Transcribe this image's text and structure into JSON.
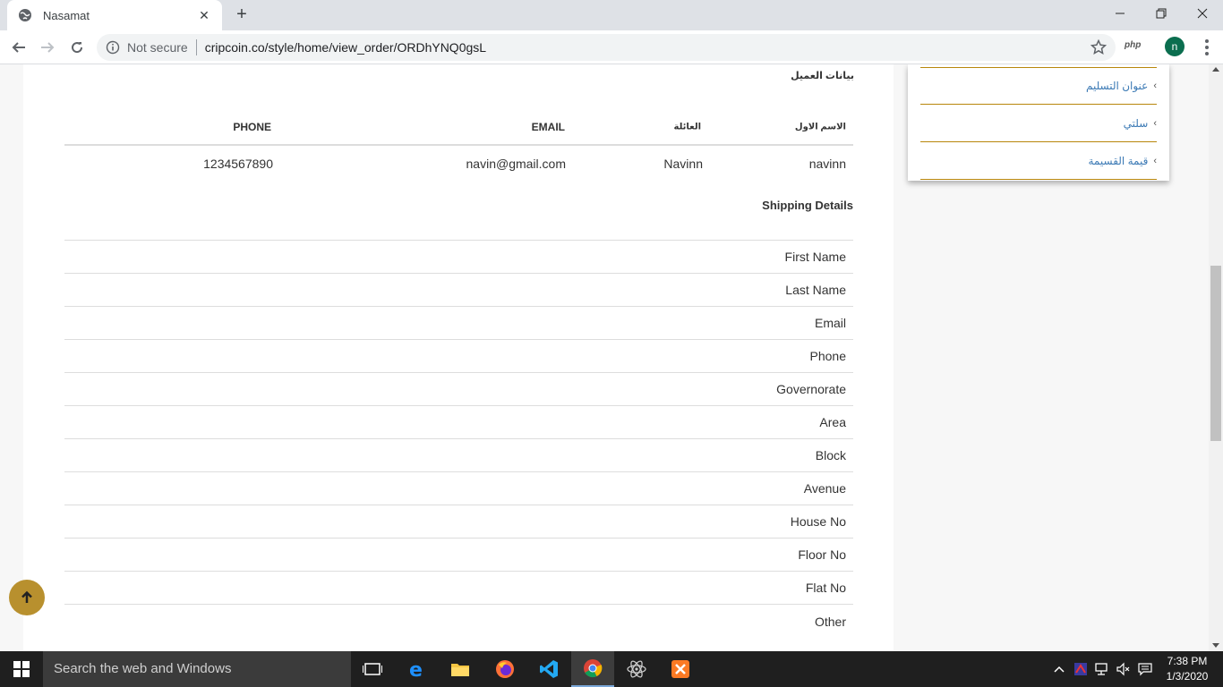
{
  "browser": {
    "tab_title": "Nasamat",
    "not_secure": "Not secure",
    "url": "cripcoin.co/style/home/view_order/ORDhYNQ0gsL",
    "extension_label": "php",
    "profile_initial": "n"
  },
  "customer": {
    "section_title": "بيانات العميل",
    "headers": {
      "first_name": "الاسم الاول",
      "family": "العائلة",
      "email": "EMAIL",
      "phone": "PHONE"
    },
    "row": {
      "first_name": "navinn",
      "family": "Navinn",
      "email": "navin@gmail.com",
      "phone": "1234567890"
    }
  },
  "shipping": {
    "title": "Shipping Details",
    "fields": [
      "First Name",
      "Last Name",
      "Email",
      "Phone",
      "Governorate",
      "Area",
      "Block",
      "Avenue",
      "House No",
      "Floor No",
      "Flat No",
      "Other"
    ]
  },
  "sidebar": {
    "items": [
      "عنوان التسليم",
      "سلتي",
      "قيمة القسيمة"
    ]
  },
  "taskbar": {
    "search_placeholder": "Search the web and Windows",
    "time": "7:38 PM",
    "date": "1/3/2020"
  },
  "colors": {
    "accent_gold": "#b8902e",
    "link_blue": "#3c7ab5"
  }
}
